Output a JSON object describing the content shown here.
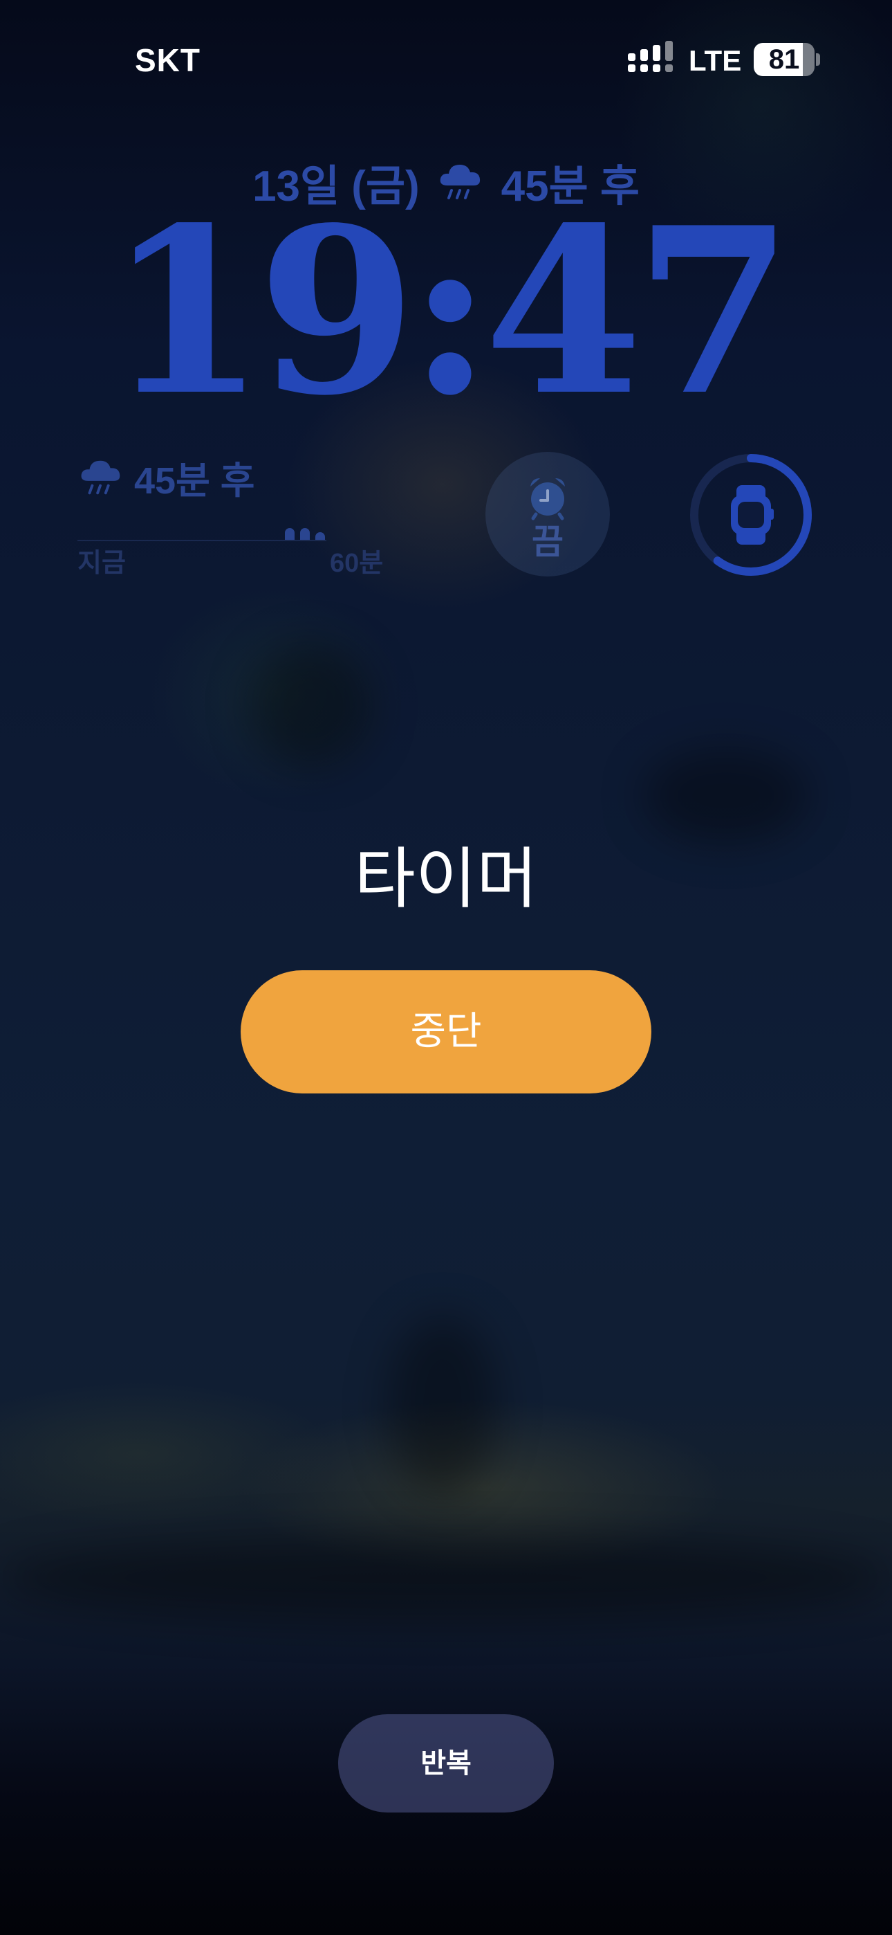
{
  "status_bar": {
    "carrier": "SKT",
    "network": "LTE",
    "battery_level": "81",
    "battery_fraction": 0.81,
    "signal_icon": "cellular-signal-icon"
  },
  "lock_screen": {
    "date_line": {
      "date": "13일 (금)",
      "weather_icon": "rain-cloud-icon",
      "forecast": "45분 후"
    },
    "time": "19:47",
    "widgets": {
      "rain": {
        "icon": "rain-cloud-icon",
        "forecast": "45분 후",
        "start_label": "지금",
        "end_label": "60분"
      },
      "alarm": {
        "icon": "alarm-clock-icon",
        "label": "끔"
      },
      "watch_battery": {
        "icon": "apple-watch-icon",
        "level_fraction": 0.6
      }
    }
  },
  "timer_alert": {
    "title": "타이머",
    "stop_label": "중단",
    "repeat_label": "반복"
  },
  "colors": {
    "stop_button": "#f0a43e",
    "clock": "#2447b8",
    "widget_text": "#2a4590"
  }
}
